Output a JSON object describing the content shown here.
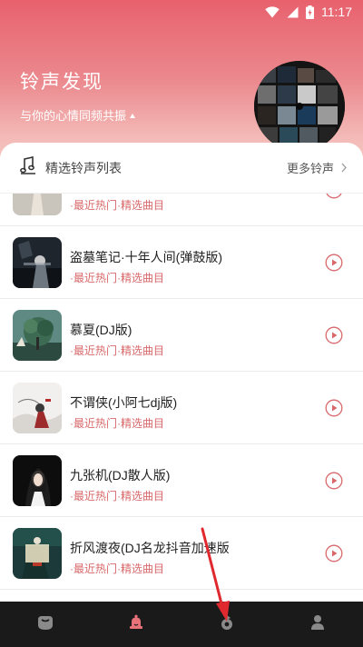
{
  "status_bar": {
    "time": "11:17"
  },
  "header": {
    "title": "铃声发现",
    "subtitle": "与你的心情同频共振"
  },
  "list_header": {
    "title": "精选铃声列表",
    "more_label": "更多铃声"
  },
  "songs": [
    {
      "title": "",
      "subtitle": "·最近热门·精选曲目"
    },
    {
      "title": "盗墓笔记·十年人间(弹鼓版)",
      "subtitle": "·最近热门·精选曲目"
    },
    {
      "title": "慕夏(DJ版)",
      "subtitle": "·最近热门·精选曲目"
    },
    {
      "title": "不谓侠(小阿七dj版)",
      "subtitle": "·最近热门·精选曲目"
    },
    {
      "title": "九张机(DJ散人版)",
      "subtitle": "·最近热门·精选曲目"
    },
    {
      "title": "折风渡夜(DJ名龙抖音加速版",
      "subtitle": "·最近热门·精选曲目"
    }
  ],
  "bottom_nav": [
    {
      "icon": "home-icon"
    },
    {
      "icon": "bell-icon"
    },
    {
      "icon": "music-note-icon"
    },
    {
      "icon": "user-icon"
    }
  ],
  "colors": {
    "header_top": "#e8616d",
    "accent": "#d8686a",
    "nav_bg": "#1a1a1a",
    "annotation_arrow": "#e0292f"
  }
}
